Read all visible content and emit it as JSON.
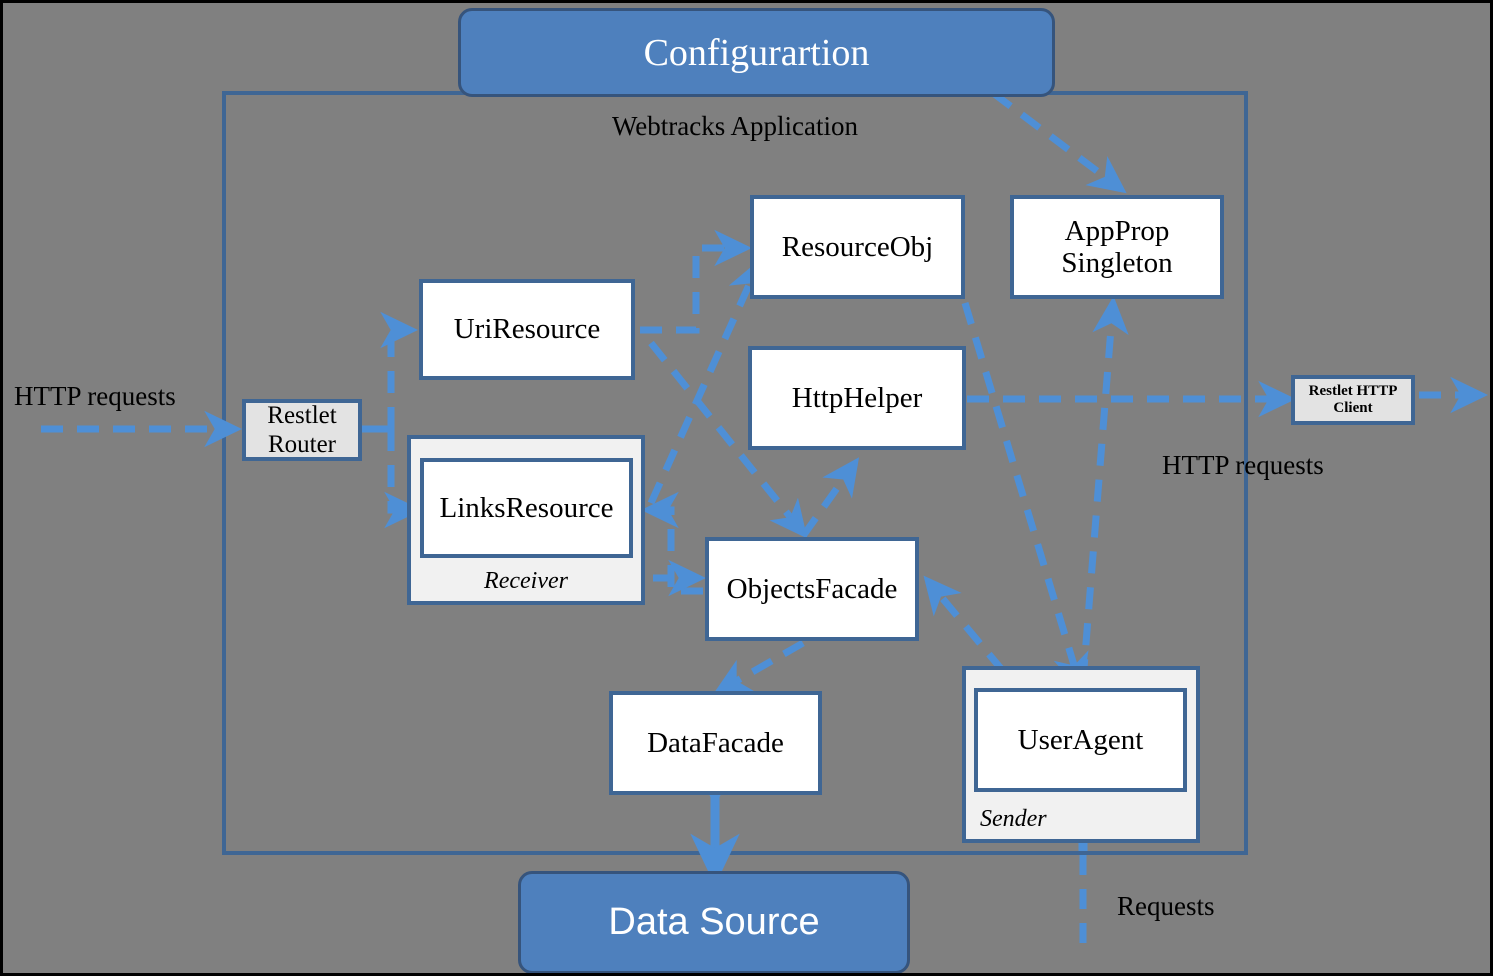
{
  "diagram": {
    "title": "Webtracks Application",
    "background_color": "#808080",
    "accent_color": "#4e80bd",
    "border_color": "#3f6694"
  },
  "capsules": [
    {
      "id": "configuration",
      "label": "Configurartion",
      "font": "serif"
    },
    {
      "id": "data_source",
      "label": "Data Source",
      "font": "sans"
    }
  ],
  "external": [
    {
      "id": "restlet_router",
      "label": "Restlet\nRouter",
      "line1": "Restlet",
      "line2": "Router"
    },
    {
      "id": "restlet_http_client",
      "label": "Restlet HTTP\nClient",
      "line1": "Restlet HTTP",
      "line2": "Client"
    }
  ],
  "components": [
    {
      "id": "uri_resource",
      "label": "UriResource"
    },
    {
      "id": "links_resource",
      "label": "LinksResource"
    },
    {
      "id": "resource_obj",
      "label": "ResourceObj"
    },
    {
      "id": "http_helper",
      "label": "HttpHelper"
    },
    {
      "id": "app_prop_singleton",
      "line1": "AppProp",
      "line2": "Singleton"
    },
    {
      "id": "objects_facade",
      "label": "ObjectsFacade"
    },
    {
      "id": "data_facade",
      "label": "DataFacade"
    },
    {
      "id": "user_agent",
      "label": "UserAgent"
    }
  ],
  "groups": [
    {
      "id": "receiver",
      "label": "Receiver"
    },
    {
      "id": "sender",
      "label": "Sender"
    }
  ],
  "labels": [
    {
      "id": "http_requests_in",
      "text": "HTTP requests"
    },
    {
      "id": "http_requests_out",
      "text": "HTTP requests"
    },
    {
      "id": "requests_in",
      "text": "Requests"
    }
  ],
  "chart_data": {
    "type": "diagram",
    "title": "Webtracks Application",
    "nodes": [
      "Configurartion",
      "Data Source",
      "Restlet Router",
      "Restlet HTTP Client",
      "UriResource",
      "LinksResource",
      "ResourceObj",
      "HttpHelper",
      "AppProp Singleton",
      "ObjectsFacade",
      "DataFacade",
      "UserAgent"
    ],
    "edges": [
      {
        "from": "HTTP requests",
        "to": "Restlet Router",
        "style": "dashed",
        "direction": "one-way"
      },
      {
        "from": "Restlet Router",
        "to": "UriResource",
        "style": "dashed",
        "direction": "one-way"
      },
      {
        "from": "Restlet Router",
        "to": "LinksResource",
        "style": "dashed",
        "direction": "one-way"
      },
      {
        "from": "UriResource",
        "to": "ResourceObj",
        "style": "dashed",
        "direction": "one-way"
      },
      {
        "from": "UriResource",
        "to": "ObjectsFacade",
        "style": "dashed",
        "direction": "one-way"
      },
      {
        "from": "LinksResource",
        "to": "ResourceObj",
        "style": "dashed",
        "direction": "one-way"
      },
      {
        "from": "LinksResource",
        "to": "ObjectsFacade",
        "style": "dashed",
        "direction": "one-way"
      },
      {
        "from": "ObjectsFacade",
        "to": "LinksResource",
        "style": "dashed",
        "direction": "one-way"
      },
      {
        "from": "ObjectsFacade",
        "to": "HttpHelper",
        "style": "dashed",
        "direction": "one-way"
      },
      {
        "from": "ObjectsFacade",
        "to": "DataFacade",
        "style": "dashed",
        "direction": "one-way"
      },
      {
        "from": "Configurartion",
        "to": "AppProp Singleton",
        "style": "dashed",
        "direction": "one-way"
      },
      {
        "from": "HttpHelper",
        "to": "Restlet HTTP Client",
        "style": "dashed",
        "direction": "one-way"
      },
      {
        "from": "Restlet HTTP Client",
        "to": "HTTP requests",
        "style": "dashed",
        "direction": "one-way"
      },
      {
        "from": "ResourceObj",
        "to": "UserAgent",
        "style": "dashed",
        "direction": "one-way"
      },
      {
        "from": "UserAgent",
        "to": "AppProp Singleton",
        "style": "dashed",
        "direction": "one-way"
      },
      {
        "from": "UserAgent",
        "to": "ObjectsFacade",
        "style": "dashed",
        "direction": "one-way"
      },
      {
        "from": "DataFacade",
        "to": "Data Source",
        "style": "solid",
        "direction": "two-way"
      },
      {
        "from": "Requests",
        "to": "UserAgent",
        "style": "dashed",
        "direction": "one-way"
      }
    ]
  }
}
